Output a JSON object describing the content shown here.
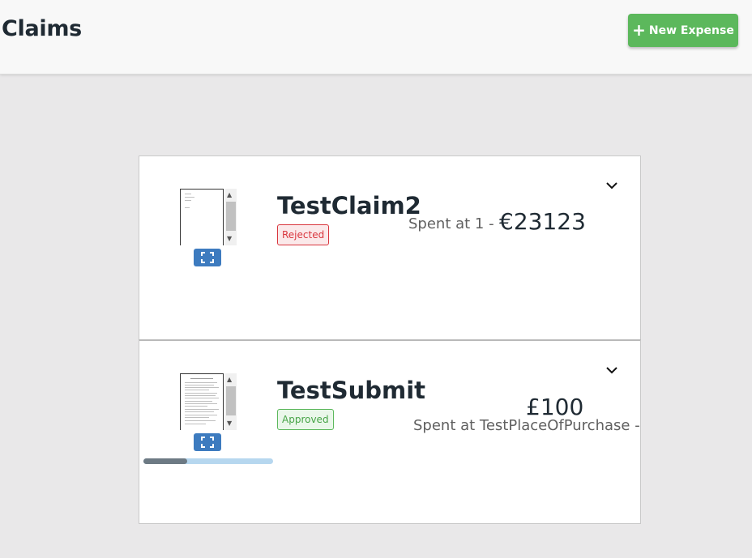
{
  "header": {
    "title": "Claims",
    "new_expense_label": "New Expense",
    "new_expense_icon": "plus-icon"
  },
  "colors": {
    "accent_green": "#5cb85c",
    "expand_blue": "#3d7bbf",
    "rejected_red": "#d9363e",
    "approved_green": "#5cb85c"
  },
  "claims": [
    {
      "name": "TestClaim2",
      "status": "Rejected",
      "spent_text": "Spent at 1 -",
      "amount": "€23123",
      "receipt_icon": "document-thumbnail",
      "expand_icon": "fullscreen-icon",
      "toggle_icon": "chevron-down-icon"
    },
    {
      "name": "TestSubmit",
      "status": "Approved",
      "spent_text": "Spent at TestPlaceOfPurchase -",
      "amount": "£100",
      "receipt_icon": "document-thumbnail",
      "expand_icon": "fullscreen-icon",
      "toggle_icon": "chevron-down-icon",
      "upload_progress": 0.34
    }
  ]
}
